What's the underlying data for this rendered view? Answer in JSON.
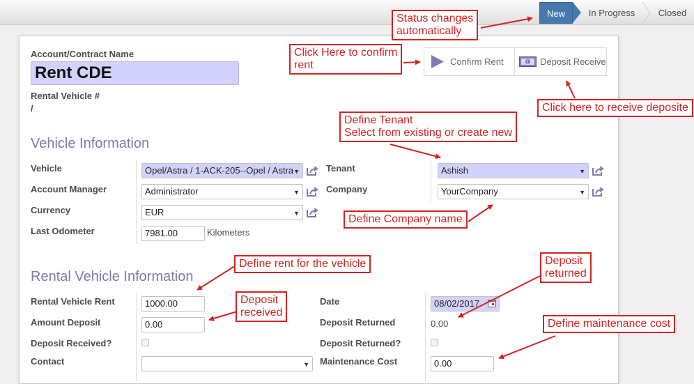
{
  "statusbar": {
    "stages": [
      {
        "label": "New",
        "active": true
      },
      {
        "label": "In Progress",
        "active": false
      },
      {
        "label": "Closed",
        "active": false
      }
    ]
  },
  "header": {
    "name_label": "Account/Contract Name",
    "name_value": "Rent CDE",
    "vehicle_no_label": "Rental Vehicle #",
    "vehicle_no_value": "/"
  },
  "buttons": {
    "confirm_label": "Confirm Rent",
    "deposit_label": "Deposit Receive"
  },
  "vehicle_info": {
    "title": "Vehicle Information",
    "vehicle_label": "Vehicle",
    "vehicle_value": "Opel/Astra / 1-ACK-205--Opel / Astra",
    "manager_label": "Account Manager",
    "manager_value": "Administrator",
    "currency_label": "Currency",
    "currency_value": "EUR",
    "odometer_label": "Last Odometer",
    "odometer_value": "7981.00",
    "odometer_unit": "Kilometers",
    "tenant_label": "Tenant",
    "tenant_value": "Ashish",
    "company_label": "Company",
    "company_value": "YourCompany"
  },
  "rental_info": {
    "title": "Rental Vehicle Information",
    "rent_label": "Rental Vehicle Rent",
    "rent_value": "1000.00",
    "deposit_label": "Amount Deposit",
    "deposit_value": "0.00",
    "deposit_received_label": "Deposit Received?",
    "contact_label": "Contact",
    "contact_value": "",
    "date_label": "Date",
    "date_value": "08/02/2017",
    "deposit_returned_label": "Deposit Returned",
    "deposit_returned_value": "0.00",
    "deposit_returned_q_label": "Deposit Returned?",
    "maintenance_label": "Maintenance Cost",
    "maintenance_value": "0.00"
  },
  "annotations": {
    "status": [
      "Status changes",
      "automatically"
    ],
    "confirm": [
      "Click Here to confirm",
      "rent"
    ],
    "deposit_receive": [
      "Click here to receive deposite"
    ],
    "tenant": [
      "Define Tenant",
      "Select from existing or create new"
    ],
    "company": [
      "Define Company name"
    ],
    "rent": [
      "Define rent for the vehicle"
    ],
    "deposit_received": [
      "Deposit",
      "received"
    ],
    "deposit_returned": [
      "Deposit",
      "returned"
    ],
    "maintenance": [
      "Define maintenance cost"
    ]
  },
  "colors": {
    "accent": "#4779ad",
    "section_title": "#7c7bad",
    "required_field": "#d2d2ff",
    "annotation": "#d42323"
  }
}
